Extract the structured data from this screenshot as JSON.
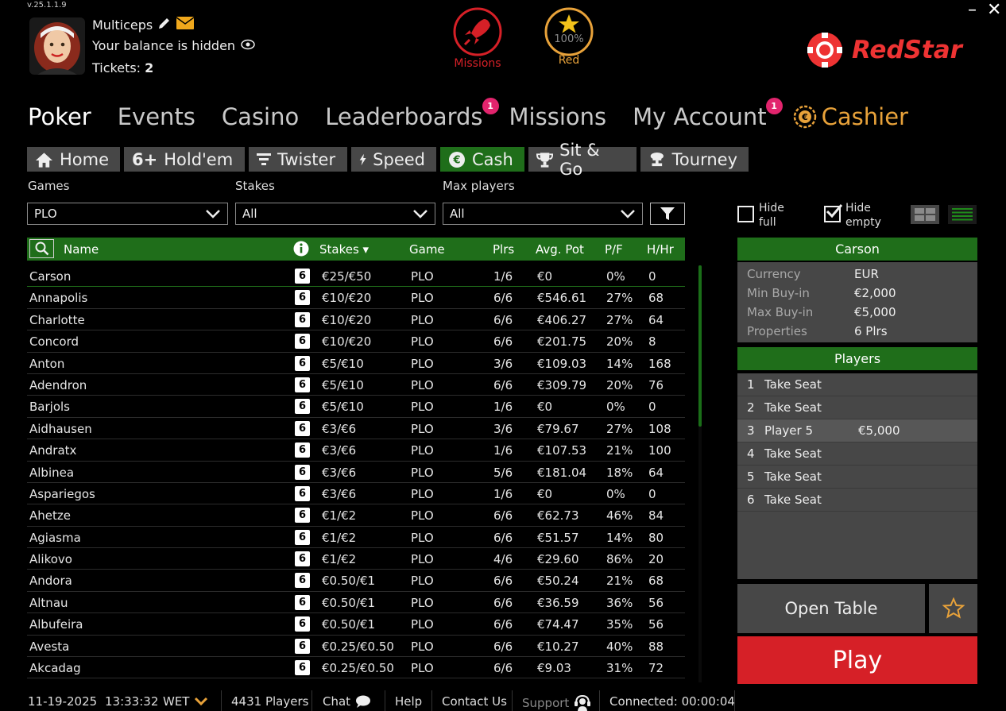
{
  "version": "v.25.1.1.9",
  "user": {
    "name": "Multiceps",
    "balance_text": "Your balance is hidden",
    "tickets_label": "Tickets:",
    "tickets_value": "2",
    "icons": [
      "pencil-icon",
      "mail-icon",
      "eye-icon"
    ]
  },
  "header_icons": {
    "missions_label": "Missions",
    "red_label": "Red",
    "red_progress_text": "100%"
  },
  "brand": {
    "name": "RedStar"
  },
  "main_nav": [
    {
      "label": "Poker",
      "active": true
    },
    {
      "label": "Events"
    },
    {
      "label": "Casino"
    },
    {
      "label": "Leaderboards",
      "badge": "1"
    },
    {
      "label": "Missions"
    },
    {
      "label": "My Account",
      "badge": "1"
    },
    {
      "label": "Cashier"
    }
  ],
  "sub_nav": [
    {
      "label": "Home",
      "icon": "home-icon"
    },
    {
      "label": "Hold'em",
      "icon": "six-plus-icon",
      "prefix": "6+"
    },
    {
      "label": "Twister",
      "icon": "twister-icon"
    },
    {
      "label": "Speed",
      "icon": "lightning-icon"
    },
    {
      "label": "Cash",
      "icon": "euro-coin-icon",
      "active": true
    },
    {
      "label": "Sit & Go",
      "icon": "trophy-icon"
    },
    {
      "label": "Tourney",
      "icon": "tourney-trophy-icon"
    }
  ],
  "filters": {
    "games_label": "Games",
    "games_value": "PLO",
    "stakes_label": "Stakes",
    "stakes_value": "All",
    "max_players_label": "Max players",
    "max_players_value": "All"
  },
  "table_headers": {
    "name": "Name",
    "stakes": "Stakes ▾",
    "game": "Game",
    "plrs": "Plrs",
    "avg_pot": "Avg. Pot",
    "pf": "P/F",
    "hhr": "H/Hr"
  },
  "tables": [
    {
      "name": "Carson",
      "max": "6",
      "stakes": "€25/€50",
      "game": "PLO",
      "plrs": "1/6",
      "avg_pot": "€0",
      "pf": "0%",
      "hhr": "0"
    },
    {
      "name": "Annapolis",
      "max": "6",
      "stakes": "€10/€20",
      "game": "PLO",
      "plrs": "6/6",
      "avg_pot": "€546.61",
      "pf": "27%",
      "hhr": "68"
    },
    {
      "name": "Charlotte",
      "max": "6",
      "stakes": "€10/€20",
      "game": "PLO",
      "plrs": "6/6",
      "avg_pot": "€406.27",
      "pf": "27%",
      "hhr": "64"
    },
    {
      "name": "Concord",
      "max": "6",
      "stakes": "€10/€20",
      "game": "PLO",
      "plrs": "6/6",
      "avg_pot": "€201.75",
      "pf": "20%",
      "hhr": "8"
    },
    {
      "name": "Anton",
      "max": "6",
      "stakes": "€5/€10",
      "game": "PLO",
      "plrs": "3/6",
      "avg_pot": "€109.03",
      "pf": "14%",
      "hhr": "168"
    },
    {
      "name": "Adendron",
      "max": "6",
      "stakes": "€5/€10",
      "game": "PLO",
      "plrs": "6/6",
      "avg_pot": "€309.79",
      "pf": "20%",
      "hhr": "76"
    },
    {
      "name": "Barjols",
      "max": "6",
      "stakes": "€5/€10",
      "game": "PLO",
      "plrs": "1/6",
      "avg_pot": "€0",
      "pf": "0%",
      "hhr": "0"
    },
    {
      "name": "Aidhausen",
      "max": "6",
      "stakes": "€3/€6",
      "game": "PLO",
      "plrs": "3/6",
      "avg_pot": "€79.67",
      "pf": "27%",
      "hhr": "108"
    },
    {
      "name": "Andratx",
      "max": "6",
      "stakes": "€3/€6",
      "game": "PLO",
      "plrs": "1/6",
      "avg_pot": "€107.53",
      "pf": "21%",
      "hhr": "100"
    },
    {
      "name": "Albinea",
      "max": "6",
      "stakes": "€3/€6",
      "game": "PLO",
      "plrs": "5/6",
      "avg_pot": "€181.04",
      "pf": "18%",
      "hhr": "64"
    },
    {
      "name": "Aspariegos",
      "max": "6",
      "stakes": "€3/€6",
      "game": "PLO",
      "plrs": "1/6",
      "avg_pot": "€0",
      "pf": "0%",
      "hhr": "0"
    },
    {
      "name": "Ahetze",
      "max": "6",
      "stakes": "€1/€2",
      "game": "PLO",
      "plrs": "6/6",
      "avg_pot": "€62.73",
      "pf": "46%",
      "hhr": "84"
    },
    {
      "name": "Agiasma",
      "max": "6",
      "stakes": "€1/€2",
      "game": "PLO",
      "plrs": "6/6",
      "avg_pot": "€51.57",
      "pf": "14%",
      "hhr": "80"
    },
    {
      "name": "Alikovo",
      "max": "6",
      "stakes": "€1/€2",
      "game": "PLO",
      "plrs": "4/6",
      "avg_pot": "€29.60",
      "pf": "86%",
      "hhr": "20"
    },
    {
      "name": "Andora",
      "max": "6",
      "stakes": "€0.50/€1",
      "game": "PLO",
      "plrs": "6/6",
      "avg_pot": "€50.24",
      "pf": "21%",
      "hhr": "68"
    },
    {
      "name": "Altnau",
      "max": "6",
      "stakes": "€0.50/€1",
      "game": "PLO",
      "plrs": "6/6",
      "avg_pot": "€36.59",
      "pf": "36%",
      "hhr": "56"
    },
    {
      "name": "Albufeira",
      "max": "6",
      "stakes": "€0.50/€1",
      "game": "PLO",
      "plrs": "6/6",
      "avg_pot": "€74.47",
      "pf": "35%",
      "hhr": "56"
    },
    {
      "name": "Avesta",
      "max": "6",
      "stakes": "€0.25/€0.50",
      "game": "PLO",
      "plrs": "6/6",
      "avg_pot": "€10.27",
      "pf": "40%",
      "hhr": "88"
    },
    {
      "name": "Akcadag",
      "max": "6",
      "stakes": "€0.25/€0.50",
      "game": "PLO",
      "plrs": "6/6",
      "avg_pot": "€9.03",
      "pf": "31%",
      "hhr": "72"
    }
  ],
  "view_options": {
    "hide_full_label_1": "Hide",
    "hide_full_label_2": "full",
    "hide_full_checked": false,
    "hide_empty_label_1": "Hide",
    "hide_empty_label_2": "empty",
    "hide_empty_checked": true
  },
  "details": {
    "title": "Carson",
    "rows": [
      {
        "key": "Currency",
        "value": "EUR"
      },
      {
        "key": "Min Buy-in",
        "value": "€2,000"
      },
      {
        "key": "Max Buy-in",
        "value": "€5,000"
      },
      {
        "key": "Properties",
        "value": "6 Plrs"
      }
    ],
    "players_title": "Players",
    "seats": [
      {
        "num": "1",
        "label": "Take Seat",
        "amount": ""
      },
      {
        "num": "2",
        "label": "Take Seat",
        "amount": ""
      },
      {
        "num": "3",
        "label": "Player 5",
        "amount": "€5,000"
      },
      {
        "num": "4",
        "label": "Take Seat",
        "amount": ""
      },
      {
        "num": "5",
        "label": "Take Seat",
        "amount": ""
      },
      {
        "num": "6",
        "label": "Take Seat",
        "amount": ""
      }
    ],
    "open_table_label": "Open Table",
    "play_label": "Play"
  },
  "status_bar": {
    "date": "11-19-2025",
    "time": "13:33:32",
    "timezone": "WET",
    "players": "4431 Players",
    "chat": "Chat",
    "help": "Help",
    "contact": "Contact Us",
    "support": "Support",
    "connected": "Connected: 00:00:04"
  },
  "colors": {
    "accent_green": "#1f6e1a",
    "play_red": "#d62027",
    "cashier_orange": "#e8a23a",
    "badge_pink": "#e2246d",
    "brand_red": "#ee3333"
  }
}
